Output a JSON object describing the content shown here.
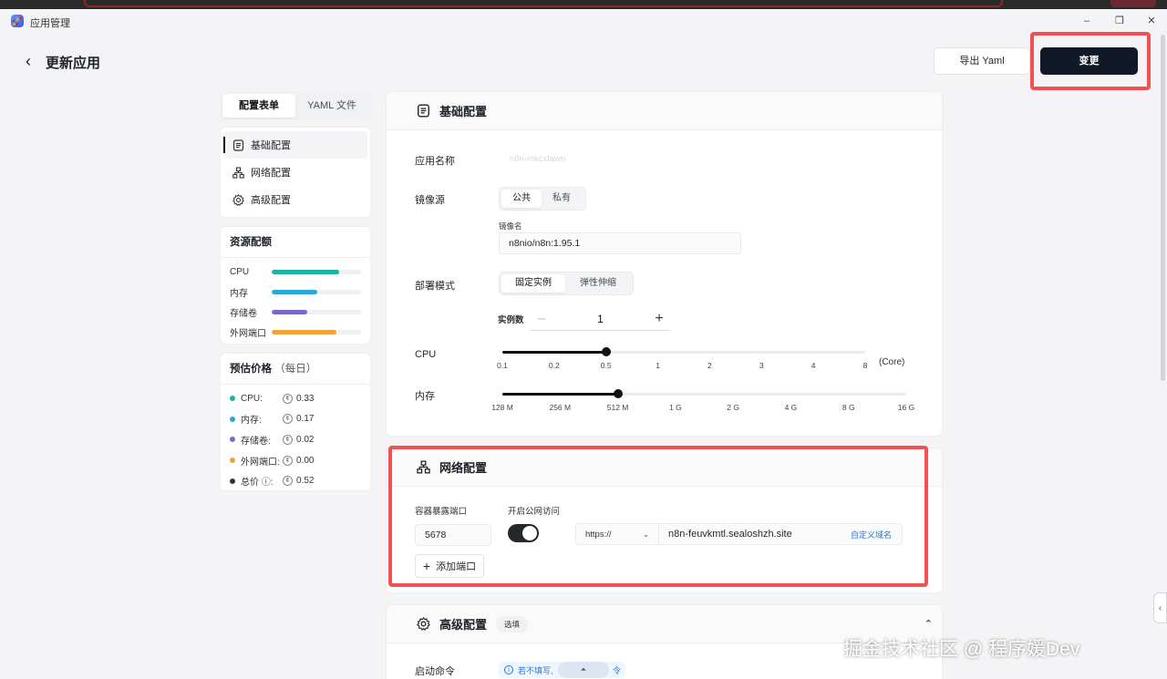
{
  "window": {
    "title": "应用管理",
    "minimize": "–",
    "restore": "❐",
    "close": "✕"
  },
  "header": {
    "back": "‹",
    "title": "更新应用",
    "export_label": "导出 Yaml",
    "change_label": "变更"
  },
  "colors": {
    "primary": "#111827",
    "highlight": "#f05254",
    "cpu": "#1ab3a6",
    "memory": "#27a8d9",
    "storage": "#7b68c8",
    "port": "#f0a33a",
    "total": "#333333"
  },
  "tabs": [
    {
      "label": "配置表单",
      "active": true
    },
    {
      "label": "YAML 文件",
      "active": false
    }
  ],
  "sidebar": {
    "items": [
      {
        "label": "基础配置",
        "icon": "document-icon",
        "active": true
      },
      {
        "label": "网络配置",
        "icon": "network-icon",
        "active": false
      },
      {
        "label": "高级配置",
        "icon": "gear-icon",
        "active": false
      }
    ]
  },
  "quota": {
    "title": "资源配额",
    "rows": [
      {
        "label": "CPU",
        "fraction": 0.75,
        "color": "#1ab3a6"
      },
      {
        "label": "内存",
        "fraction": 0.51,
        "color": "#27a8d9"
      },
      {
        "label": "存储卷",
        "fraction": 0.4,
        "color": "#7b68c8"
      },
      {
        "label": "外网端口",
        "fraction": 0.72,
        "color": "#f0a33a"
      }
    ]
  },
  "price": {
    "title": "预估价格",
    "subtitle": "（每日）",
    "rows": [
      {
        "label": "CPU:",
        "value": "0.33",
        "color": "#1ab3a6"
      },
      {
        "label": "内存:",
        "value": "0.17",
        "color": "#27a8d9"
      },
      {
        "label": "存储卷:",
        "value": "0.02",
        "color": "#7b68c8"
      },
      {
        "label": "外网端口:",
        "value": "0.00",
        "color": "#f0a33a"
      },
      {
        "label": "总价 ⓘ:",
        "value": "0.52",
        "color": "#333333"
      }
    ]
  },
  "basic": {
    "title": "基础配置",
    "app_name_label": "应用名称",
    "app_name_value": "n8n-mkcxfawn",
    "image_source_label": "镜像源",
    "image_source_options": [
      {
        "label": "公共",
        "active": true
      },
      {
        "label": "私有",
        "active": false
      }
    ],
    "image_name_label": "镜像名",
    "image_name_value": "n8nio/n8n:1.95.1",
    "deploy_mode_label": "部署模式",
    "deploy_mode_options": [
      {
        "label": "固定实例",
        "active": true
      },
      {
        "label": "弹性伸缩",
        "active": false
      }
    ],
    "instances_label": "实例数",
    "instances_value": "1",
    "minus": "–",
    "plus": "+",
    "cpu_label": "CPU",
    "cpu_unit": "(Core)",
    "cpu_ticks": [
      "0.1",
      "0.2",
      "0.5",
      "1",
      "2",
      "3",
      "4",
      "8"
    ],
    "cpu_selected_index": 2,
    "memory_label": "内存",
    "memory_ticks": [
      "128 M",
      "256 M",
      "512 M",
      "1 G",
      "2 G",
      "4 G",
      "8 G",
      "16 G"
    ],
    "memory_selected_index": 2
  },
  "network": {
    "title": "网络配置",
    "port_label": "容器暴露端口",
    "port_value": "5678",
    "public_label": "开启公网访问",
    "public_enabled": true,
    "protocol": "https://",
    "domain": "n8n-feuvkmtl.sealoshzh.site",
    "custom_domain": "自定义域名",
    "add_port_label": "添加端口",
    "add_icon": "+"
  },
  "advanced": {
    "title": "高级配置",
    "badge": "选填",
    "collapse_icon": "⌃",
    "start_cmd_label": "启动命令",
    "tip_prefix": "若不填写,",
    "tip_suffix": "令",
    "tip_overlay_icon": "⏶"
  },
  "watermark": "掘金技术社区 @ 程序媛Dev",
  "side_handle_icon": "‹"
}
